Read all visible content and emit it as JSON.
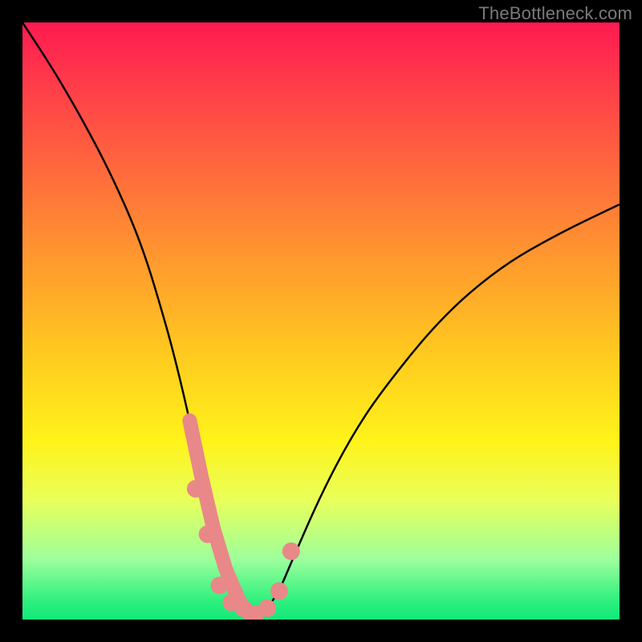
{
  "watermark": "TheBottleneck.com",
  "colors": {
    "background": "#000000",
    "curve": "#000000",
    "marker_fill": "#e98888",
    "marker_stroke": "#a83f44"
  },
  "chart_data": {
    "type": "line",
    "title": "",
    "xlabel": "",
    "ylabel": "",
    "x": [
      0,
      5,
      10,
      15,
      20,
      24,
      26,
      28,
      30,
      32,
      34,
      36,
      37,
      38,
      39,
      40,
      41,
      43,
      45,
      50,
      55,
      60,
      70,
      80,
      90,
      100
    ],
    "values": [
      105,
      97,
      88,
      78,
      66,
      52,
      44,
      35,
      25,
      16,
      9,
      4,
      2,
      1,
      1,
      1,
      2,
      5,
      10,
      22,
      32,
      40,
      53,
      62,
      68,
      73
    ],
    "ylim": [
      0,
      105
    ],
    "markers": {
      "x": [
        29,
        31,
        33,
        35,
        37,
        39,
        41,
        43,
        45
      ],
      "y": [
        23,
        15,
        6,
        3,
        2,
        1,
        2,
        5,
        12
      ]
    },
    "gradient_scale": [
      {
        "pct": 0,
        "color": "#ff1a50"
      },
      {
        "pct": 50,
        "color": "#ffe020"
      },
      {
        "pct": 100,
        "color": "#14e87a"
      }
    ]
  }
}
